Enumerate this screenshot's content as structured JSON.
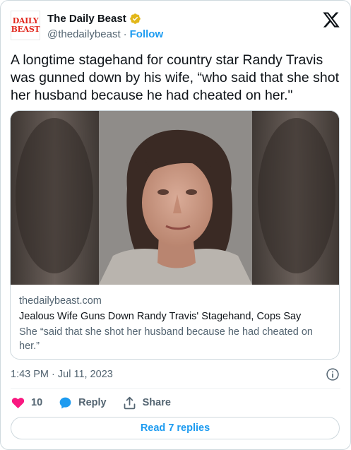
{
  "account": {
    "logo_text_line1": "DAILY",
    "logo_text_line2": "BEAST",
    "name": "The Daily Beast",
    "handle": "@thedailybeast",
    "separator": "·",
    "follow_label": "Follow"
  },
  "tweet": {
    "text": "A longtime stagehand for country star Randy Travis was gunned down by his wife, “who said that she shot her husband because he had cheated on her.\""
  },
  "link_card": {
    "domain": "thedailybeast.com",
    "title": "Jealous Wife Guns Down Randy Travis' Stagehand, Cops Say",
    "description": "She “said that she shot her husband because he had cheated on her.”"
  },
  "meta": {
    "timestamp": "1:43 PM · Jul 11, 2023"
  },
  "actions": {
    "like_count": "10",
    "reply_label": "Reply",
    "share_label": "Share"
  },
  "replies_button": {
    "label": "Read 7 replies"
  },
  "colors": {
    "accent": "#1d9bf0",
    "like": "#f91880",
    "verified_gold": "#e2b719",
    "brand_red": "#e1261c"
  }
}
